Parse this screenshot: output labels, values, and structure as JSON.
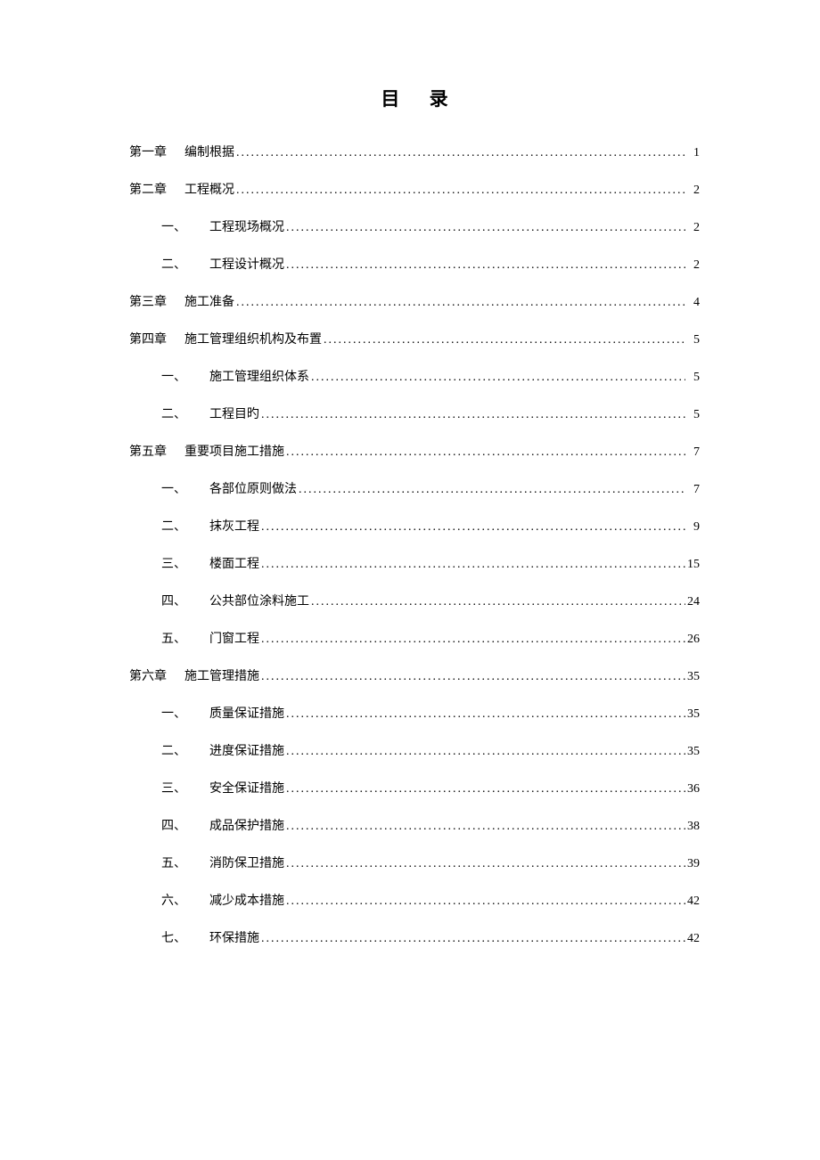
{
  "title": "目 录",
  "toc": [
    {
      "level": 1,
      "prefix": "第一章",
      "text": "编制根据",
      "page": "1"
    },
    {
      "level": 1,
      "prefix": "第二章",
      "text": "工程概况",
      "page": "2"
    },
    {
      "level": 2,
      "prefix": "一、",
      "text": "工程现场概况",
      "page": "2"
    },
    {
      "level": 2,
      "prefix": "二、",
      "text": "工程设计概况",
      "page": "2"
    },
    {
      "level": 1,
      "prefix": "第三章",
      "text": "施工准备",
      "page": "4"
    },
    {
      "level": 1,
      "prefix": "第四章",
      "text": "施工管理组织机构及布置",
      "page": "5"
    },
    {
      "level": 2,
      "prefix": "一、",
      "text": "施工管理组织体系",
      "page": "5"
    },
    {
      "level": 2,
      "prefix": "二、",
      "text": "工程目旳",
      "page": "5"
    },
    {
      "level": 1,
      "prefix": "第五章",
      "text": "重要项目施工措施",
      "page": "7"
    },
    {
      "level": 2,
      "prefix": "一、",
      "text": "各部位原则做法",
      "page": "7"
    },
    {
      "level": 2,
      "prefix": "二、",
      "text": "抹灰工程",
      "page": "9"
    },
    {
      "level": 2,
      "prefix": "三、",
      "text": "楼面工程",
      "page": "15"
    },
    {
      "level": 2,
      "prefix": "四、",
      "text": "公共部位涂料施工",
      "page": "24"
    },
    {
      "level": 2,
      "prefix": "五、",
      "text": "门窗工程",
      "page": "26"
    },
    {
      "level": 1,
      "prefix": "第六章",
      "text": "施工管理措施",
      "page": "35"
    },
    {
      "level": 2,
      "prefix": "一、",
      "text": "质量保证措施",
      "page": "35"
    },
    {
      "level": 2,
      "prefix": "二、",
      "text": "进度保证措施",
      "page": "35"
    },
    {
      "level": 2,
      "prefix": "三、",
      "text": "安全保证措施",
      "page": "36"
    },
    {
      "level": 2,
      "prefix": "四、",
      "text": "成品保护措施",
      "page": "38"
    },
    {
      "level": 2,
      "prefix": "五、",
      "text": "消防保卫措施",
      "page": "39"
    },
    {
      "level": 2,
      "prefix": "六、",
      "text": "减少成本措施",
      "page": "42"
    },
    {
      "level": 2,
      "prefix": "七、",
      "text": "环保措施",
      "page": "42"
    }
  ]
}
